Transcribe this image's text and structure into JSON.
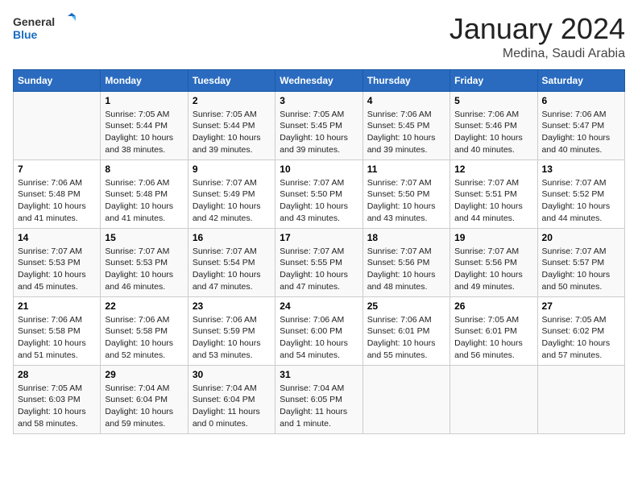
{
  "header": {
    "logo_general": "General",
    "logo_blue": "Blue",
    "month_title": "January 2024",
    "location": "Medina, Saudi Arabia"
  },
  "days_of_week": [
    "Sunday",
    "Monday",
    "Tuesday",
    "Wednesday",
    "Thursday",
    "Friday",
    "Saturday"
  ],
  "weeks": [
    [
      {
        "day": "",
        "sunrise": "",
        "sunset": "",
        "daylight": ""
      },
      {
        "day": "1",
        "sunrise": "Sunrise: 7:05 AM",
        "sunset": "Sunset: 5:44 PM",
        "daylight": "Daylight: 10 hours and 38 minutes."
      },
      {
        "day": "2",
        "sunrise": "Sunrise: 7:05 AM",
        "sunset": "Sunset: 5:44 PM",
        "daylight": "Daylight: 10 hours and 39 minutes."
      },
      {
        "day": "3",
        "sunrise": "Sunrise: 7:05 AM",
        "sunset": "Sunset: 5:45 PM",
        "daylight": "Daylight: 10 hours and 39 minutes."
      },
      {
        "day": "4",
        "sunrise": "Sunrise: 7:06 AM",
        "sunset": "Sunset: 5:45 PM",
        "daylight": "Daylight: 10 hours and 39 minutes."
      },
      {
        "day": "5",
        "sunrise": "Sunrise: 7:06 AM",
        "sunset": "Sunset: 5:46 PM",
        "daylight": "Daylight: 10 hours and 40 minutes."
      },
      {
        "day": "6",
        "sunrise": "Sunrise: 7:06 AM",
        "sunset": "Sunset: 5:47 PM",
        "daylight": "Daylight: 10 hours and 40 minutes."
      }
    ],
    [
      {
        "day": "7",
        "sunrise": "Sunrise: 7:06 AM",
        "sunset": "Sunset: 5:48 PM",
        "daylight": "Daylight: 10 hours and 41 minutes."
      },
      {
        "day": "8",
        "sunrise": "Sunrise: 7:06 AM",
        "sunset": "Sunset: 5:48 PM",
        "daylight": "Daylight: 10 hours and 41 minutes."
      },
      {
        "day": "9",
        "sunrise": "Sunrise: 7:07 AM",
        "sunset": "Sunset: 5:49 PM",
        "daylight": "Daylight: 10 hours and 42 minutes."
      },
      {
        "day": "10",
        "sunrise": "Sunrise: 7:07 AM",
        "sunset": "Sunset: 5:50 PM",
        "daylight": "Daylight: 10 hours and 43 minutes."
      },
      {
        "day": "11",
        "sunrise": "Sunrise: 7:07 AM",
        "sunset": "Sunset: 5:50 PM",
        "daylight": "Daylight: 10 hours and 43 minutes."
      },
      {
        "day": "12",
        "sunrise": "Sunrise: 7:07 AM",
        "sunset": "Sunset: 5:51 PM",
        "daylight": "Daylight: 10 hours and 44 minutes."
      },
      {
        "day": "13",
        "sunrise": "Sunrise: 7:07 AM",
        "sunset": "Sunset: 5:52 PM",
        "daylight": "Daylight: 10 hours and 44 minutes."
      }
    ],
    [
      {
        "day": "14",
        "sunrise": "Sunrise: 7:07 AM",
        "sunset": "Sunset: 5:53 PM",
        "daylight": "Daylight: 10 hours and 45 minutes."
      },
      {
        "day": "15",
        "sunrise": "Sunrise: 7:07 AM",
        "sunset": "Sunset: 5:53 PM",
        "daylight": "Daylight: 10 hours and 46 minutes."
      },
      {
        "day": "16",
        "sunrise": "Sunrise: 7:07 AM",
        "sunset": "Sunset: 5:54 PM",
        "daylight": "Daylight: 10 hours and 47 minutes."
      },
      {
        "day": "17",
        "sunrise": "Sunrise: 7:07 AM",
        "sunset": "Sunset: 5:55 PM",
        "daylight": "Daylight: 10 hours and 47 minutes."
      },
      {
        "day": "18",
        "sunrise": "Sunrise: 7:07 AM",
        "sunset": "Sunset: 5:56 PM",
        "daylight": "Daylight: 10 hours and 48 minutes."
      },
      {
        "day": "19",
        "sunrise": "Sunrise: 7:07 AM",
        "sunset": "Sunset: 5:56 PM",
        "daylight": "Daylight: 10 hours and 49 minutes."
      },
      {
        "day": "20",
        "sunrise": "Sunrise: 7:07 AM",
        "sunset": "Sunset: 5:57 PM",
        "daylight": "Daylight: 10 hours and 50 minutes."
      }
    ],
    [
      {
        "day": "21",
        "sunrise": "Sunrise: 7:06 AM",
        "sunset": "Sunset: 5:58 PM",
        "daylight": "Daylight: 10 hours and 51 minutes."
      },
      {
        "day": "22",
        "sunrise": "Sunrise: 7:06 AM",
        "sunset": "Sunset: 5:58 PM",
        "daylight": "Daylight: 10 hours and 52 minutes."
      },
      {
        "day": "23",
        "sunrise": "Sunrise: 7:06 AM",
        "sunset": "Sunset: 5:59 PM",
        "daylight": "Daylight: 10 hours and 53 minutes."
      },
      {
        "day": "24",
        "sunrise": "Sunrise: 7:06 AM",
        "sunset": "Sunset: 6:00 PM",
        "daylight": "Daylight: 10 hours and 54 minutes."
      },
      {
        "day": "25",
        "sunrise": "Sunrise: 7:06 AM",
        "sunset": "Sunset: 6:01 PM",
        "daylight": "Daylight: 10 hours and 55 minutes."
      },
      {
        "day": "26",
        "sunrise": "Sunrise: 7:05 AM",
        "sunset": "Sunset: 6:01 PM",
        "daylight": "Daylight: 10 hours and 56 minutes."
      },
      {
        "day": "27",
        "sunrise": "Sunrise: 7:05 AM",
        "sunset": "Sunset: 6:02 PM",
        "daylight": "Daylight: 10 hours and 57 minutes."
      }
    ],
    [
      {
        "day": "28",
        "sunrise": "Sunrise: 7:05 AM",
        "sunset": "Sunset: 6:03 PM",
        "daylight": "Daylight: 10 hours and 58 minutes."
      },
      {
        "day": "29",
        "sunrise": "Sunrise: 7:04 AM",
        "sunset": "Sunset: 6:04 PM",
        "daylight": "Daylight: 10 hours and 59 minutes."
      },
      {
        "day": "30",
        "sunrise": "Sunrise: 7:04 AM",
        "sunset": "Sunset: 6:04 PM",
        "daylight": "Daylight: 11 hours and 0 minutes."
      },
      {
        "day": "31",
        "sunrise": "Sunrise: 7:04 AM",
        "sunset": "Sunset: 6:05 PM",
        "daylight": "Daylight: 11 hours and 1 minute."
      },
      {
        "day": "",
        "sunrise": "",
        "sunset": "",
        "daylight": ""
      },
      {
        "day": "",
        "sunrise": "",
        "sunset": "",
        "daylight": ""
      },
      {
        "day": "",
        "sunrise": "",
        "sunset": "",
        "daylight": ""
      }
    ]
  ]
}
